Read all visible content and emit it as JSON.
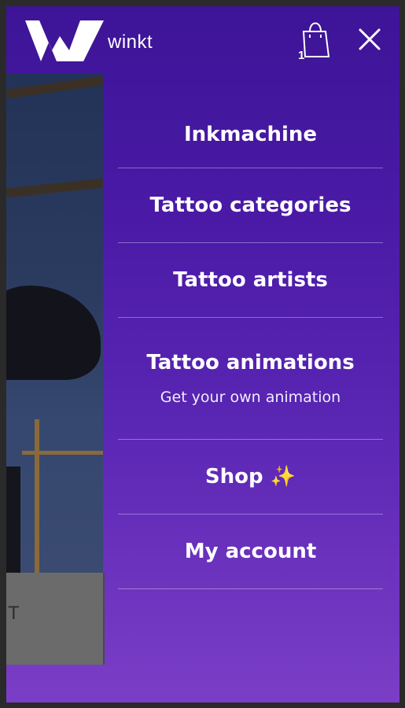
{
  "brand": {
    "name": "winkt"
  },
  "cart": {
    "count": "1",
    "icon": "shopping-bag-icon"
  },
  "close": {
    "icon": "close-icon"
  },
  "menu": {
    "items": [
      {
        "label": "Inkmachine"
      },
      {
        "label": "Tattoo categories"
      },
      {
        "label": "Tattoo artists"
      },
      {
        "label": "Tattoo animations",
        "sub": "Get your own animation"
      },
      {
        "label": "Shop ✨"
      },
      {
        "label": "My account"
      }
    ]
  },
  "background": {
    "panel_text": "T"
  },
  "colors": {
    "gradient_top": "#3d1497",
    "gradient_bottom": "#7b3ec6",
    "text": "#ffffff"
  }
}
